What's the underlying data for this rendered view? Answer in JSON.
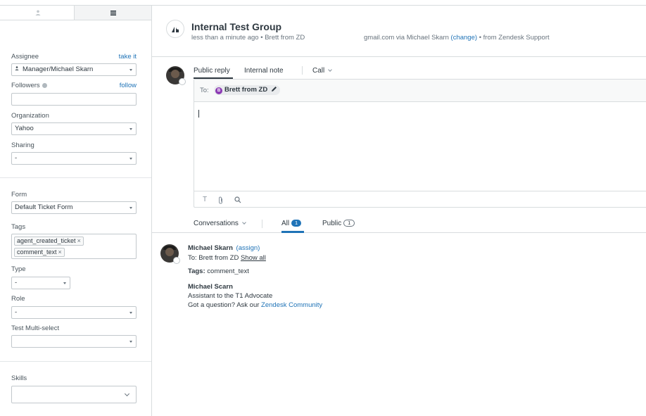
{
  "sidebar": {
    "assignee": {
      "label": "Assignee",
      "action": "take it",
      "value": "Manager/Michael Skarn"
    },
    "followers": {
      "label": "Followers",
      "action": "follow",
      "value": ""
    },
    "organization": {
      "label": "Organization",
      "value": "Yahoo"
    },
    "sharing": {
      "label": "Sharing",
      "value": "-"
    },
    "form": {
      "label": "Form",
      "value": "Default Ticket Form"
    },
    "tags": {
      "label": "Tags",
      "items": [
        "agent_created_ticket",
        "comment_text"
      ],
      "remove_glyph": "×"
    },
    "type": {
      "label": "Type",
      "value": "-"
    },
    "role": {
      "label": "Role",
      "value": "-"
    },
    "multiselect": {
      "label": "Test Multi-select",
      "value": ""
    },
    "skills": {
      "label": "Skills",
      "value": ""
    }
  },
  "header": {
    "title": "Internal Test Group",
    "meta_left": "less than a minute ago • Brett from ZD",
    "meta_email": "gmail.com via Michael Skarn",
    "meta_change": "(change)",
    "meta_source": "• from Zendesk Support"
  },
  "composer": {
    "tabs": [
      "Public reply",
      "Internal note",
      "Call"
    ],
    "to_label": "To:",
    "to_initial": "B",
    "to_name": "Brett from ZD",
    "tools": [
      "T",
      "📎",
      "⚲"
    ]
  },
  "conversation_tabs": {
    "conversations": "Conversations",
    "all": "All",
    "all_count": "1",
    "public": "Public",
    "public_count": "1"
  },
  "message": {
    "author": "Michael Skarn",
    "assign": "(assign)",
    "to": "To: Brett from ZD",
    "show_all": "Show all",
    "tags_label": "Tags:",
    "tags_value": "comment_text",
    "sig_name": "Michael Scarn",
    "sig_title": "Assistant to the T1 Advocate",
    "question": "Got a question? Ask our",
    "community_link": "Zendesk Community"
  },
  "colors": {
    "accent": "#1f73b7",
    "border": "#d8dcde",
    "chip_initial": "#8c3bb4"
  }
}
